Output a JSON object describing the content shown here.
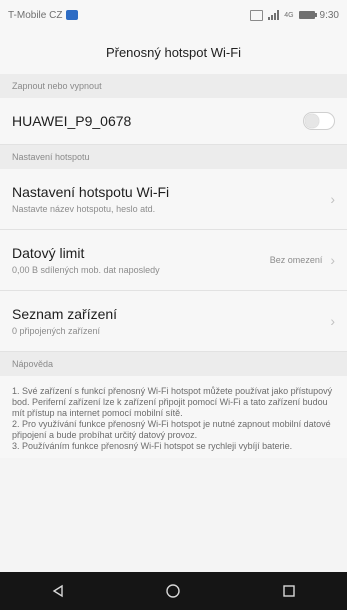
{
  "status_bar": {
    "carrier": "T-Mobile CZ",
    "time": "9:30",
    "signal": "4G",
    "icons": [
      "notification-icon",
      "gallery-icon",
      "signal-icon",
      "battery-icon"
    ]
  },
  "title": "Přenosný hotspot Wi-Fi",
  "sections": {
    "toggle_header": "Zapnout nebo vypnout",
    "settings_header": "Nastavení hotspotu",
    "help_header": "Nápověda"
  },
  "hotspot": {
    "ssid": "HUAWEI_P9_0678",
    "enabled": false
  },
  "settings_rows": [
    {
      "title": "Nastavení hotspotu Wi-Fi",
      "subtitle": "Nastavte název hotspotu, heslo atd.",
      "value": ""
    },
    {
      "title": "Datový limit",
      "subtitle": "0,00 B sdílených mob. dat naposledy",
      "value": "Bez omezení"
    },
    {
      "title": "Seznam zařízení",
      "subtitle": "0 připojených zařízení",
      "value": ""
    }
  ],
  "help": {
    "items": [
      "1. Své zařízení s funkcí přenosný Wi-Fi hotspot můžete používat jako přístupový bod. Periferní zařízení lze k zařízení připojit pomocí Wi-Fi a tato zařízení budou mít přístup na internet pomocí mobilní sítě.",
      "2. Pro využívání funkce přenosný Wi-Fi hotspot je nutné zapnout mobilní datové připojení a bude probíhat určitý datový provoz.",
      "3. Používáním funkce přenosný Wi-Fi hotspot se rychleji vybíjí baterie."
    ]
  },
  "nav": {
    "buttons": [
      "back-icon",
      "home-icon",
      "recents-icon"
    ]
  },
  "colors": {
    "background": "#f4f4f4",
    "section_header_bg": "#ececec",
    "nav_bar": "#151515",
    "notification_icon": "#2d6cc4"
  }
}
